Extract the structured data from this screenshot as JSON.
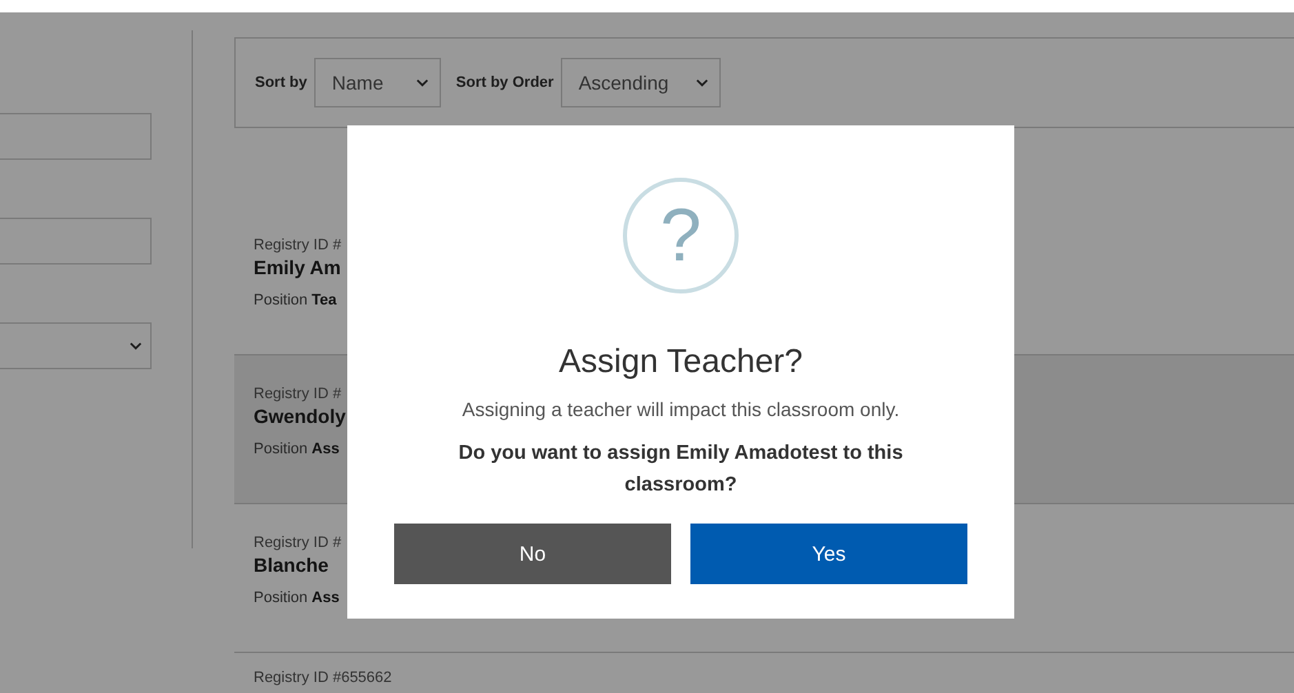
{
  "filters": {
    "fields": [
      {
        "kind": "input"
      },
      {
        "kind": "input"
      },
      {
        "kind": "select"
      }
    ]
  },
  "sort": {
    "fields": [
      {
        "label": "Sort by",
        "value": "Name"
      },
      {
        "label": "Sort by Order",
        "value": "Ascending"
      }
    ]
  },
  "staff": [
    {
      "registry": "Registry ID #",
      "name": "Emily Am",
      "position_label": "Position",
      "position": "Tea",
      "selected": false
    },
    {
      "registry": "Registry ID #",
      "name": "Gwendoly",
      "position_label": "Position",
      "position": "Ass",
      "selected": true
    },
    {
      "registry": "Registry ID #",
      "name": "Blanche",
      "position_label": "Position",
      "position": "Ass",
      "selected": false
    },
    {
      "registry": "Registry ID #655662",
      "selected": false
    }
  ],
  "modal": {
    "icon": "?",
    "title": "Assign Teacher?",
    "message": "Assigning a teacher will impact this classroom only.",
    "question": "Do you want to assign Emily Amadotest to this classroom?",
    "buttons": [
      {
        "label": "No",
        "kind": "secondary"
      },
      {
        "label": "Yes",
        "kind": "primary"
      }
    ]
  }
}
